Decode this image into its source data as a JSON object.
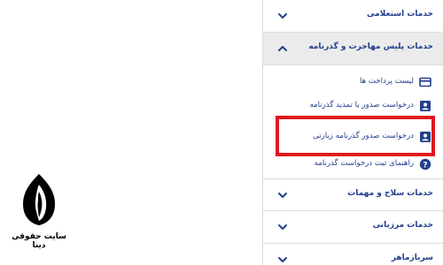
{
  "brand": {
    "site_name": "سایت حقوقی دینا"
  },
  "menu": {
    "categories_top": [
      {
        "label": "خدمات استعلامی",
        "state": "collapsed"
      },
      {
        "label": "خدمات پلیس مهاجرت و گذرنامه",
        "state": "expanded"
      }
    ],
    "subitems": [
      {
        "label": "لیست پرداخت ها",
        "icon": "credit-card-icon"
      },
      {
        "label": "درخواست صدور یا تمدید گذرنامه",
        "icon": "id-badge-icon"
      },
      {
        "label": "درخواست صدور گذرنامه زیارتی",
        "icon": "id-badge-icon",
        "highlighted": true
      },
      {
        "label": "راهنمای ثبت درخواست گذرنامه",
        "icon": "help-circle-icon"
      }
    ],
    "categories_bottom": [
      {
        "label": "خدمات سلاح و مهمات",
        "state": "collapsed"
      },
      {
        "label": "خدمات مرزبانی",
        "state": "collapsed"
      },
      {
        "label": "سربازماهر",
        "state": "collapsed"
      }
    ]
  },
  "colors": {
    "link": "#23408e",
    "highlight_border": "#e0151e",
    "expanded_bg": "#ebebeb"
  }
}
